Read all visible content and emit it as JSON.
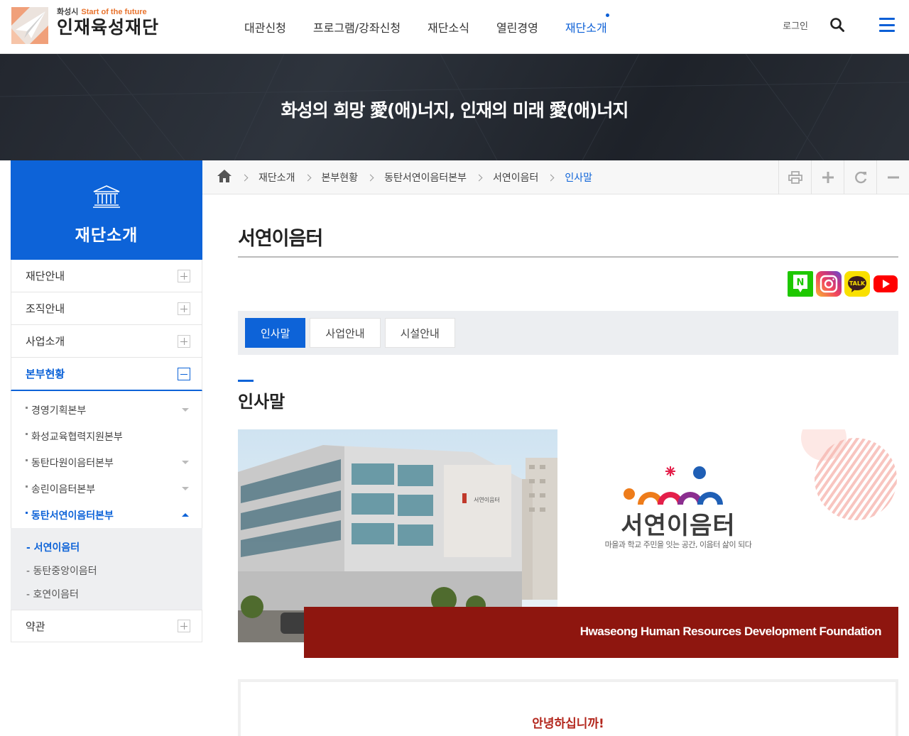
{
  "header": {
    "logo_small": "화성시",
    "logo_tagline": "Start of the future",
    "logo_name": "인재육성재단",
    "nav": [
      "대관신청",
      "프로그램/강좌신청",
      "재단소식",
      "열린경영",
      "재단소개"
    ],
    "nav_active_index": 4,
    "login_label": "로그인",
    "accent_color": "#0d63d8"
  },
  "banner": {
    "slogan": "화성의 희망 愛(애)너지, 인재의 미래 愛(애)너지"
  },
  "lnb": {
    "title": "재단소개",
    "items": [
      "재단안내",
      "조직안내",
      "사업소개",
      "본부현황"
    ],
    "active_item": "본부현황",
    "sub_items": [
      "경영기획본부",
      "화성교육협력지원본부",
      "동탄다원이음터본부",
      "송린이음터본부",
      "동탄서연이음터본부"
    ],
    "active_sub": "동탄서연이음터본부",
    "sub3_items": [
      "- 서연이음터",
      "- 동탄중앙이음터",
      "- 호연이음터"
    ],
    "active_sub3": "- 서연이음터",
    "last_item": "약관"
  },
  "breadcrumb": [
    "재단소개",
    "본부현황",
    "동탄서연이음터본부",
    "서연이음터",
    "인사말"
  ],
  "page": {
    "title": "서연이음터",
    "tabs": [
      "인사말",
      "사업안내",
      "시설안내"
    ],
    "active_tab": "인사말",
    "section_title": "인사말",
    "visual_logo_name": "서연이음터",
    "visual_logo_slogan": "마을과 학교 주민을 잇는 공간, 이음터 삶이 되다",
    "visual_caption": "Hwaseong Human Resources Development Foundation",
    "greeting": "안녕하십니까!"
  },
  "sns": [
    "naver-blog-icon",
    "instagram-icon",
    "kakaotalk-icon",
    "youtube-icon"
  ],
  "colors": {
    "brand_blue": "#0d63d8",
    "brand_red": "#8e160f",
    "greeting_red": "#b3271d"
  }
}
